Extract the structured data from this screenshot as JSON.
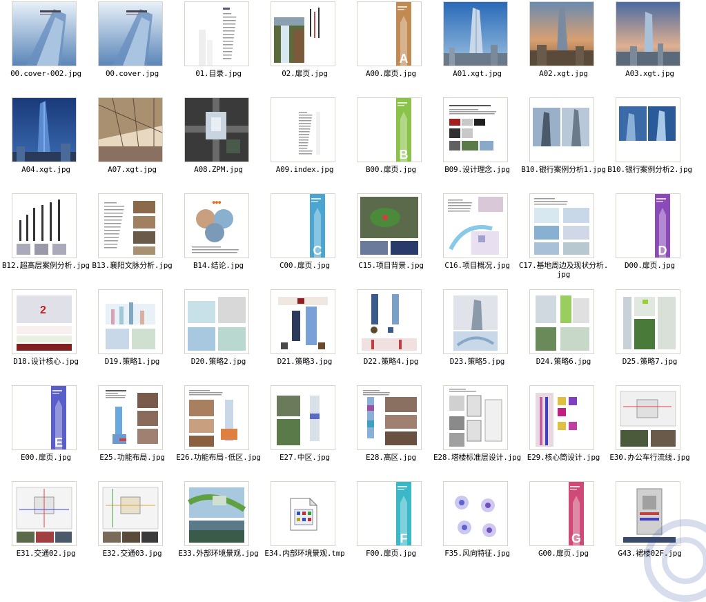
{
  "files": [
    {
      "name": "00.cover-002.jpg",
      "thumb": "cover"
    },
    {
      "name": "00.cover.jpg",
      "thumb": "cover"
    },
    {
      "name": "01.目录.jpg",
      "thumb": "toc"
    },
    {
      "name": "02.扉页.jpg",
      "thumb": "waterfall"
    },
    {
      "name": "A00.扉页.jpg",
      "thumb": "divider",
      "letter": "A",
      "color": "#c08a52"
    },
    {
      "name": "A01.xgt.jpg",
      "thumb": "tower_blue"
    },
    {
      "name": "A02.xgt.jpg",
      "thumb": "tower_sunset"
    },
    {
      "name": "A03.xgt.jpg",
      "thumb": "tower_city"
    },
    {
      "name": "A04.xgt.jpg",
      "thumb": "tower_night"
    },
    {
      "name": "A07.xgt.jpg",
      "thumb": "atrium"
    },
    {
      "name": "A08.ZPM.jpg",
      "thumb": "siteplan"
    },
    {
      "name": "A09.index.jpg",
      "thumb": "index"
    },
    {
      "name": "B00.扉页.jpg",
      "thumb": "divider",
      "letter": "B",
      "color": "#8ac24a"
    },
    {
      "name": "B09.设计理念.jpg",
      "thumb": "concept"
    },
    {
      "name": "B10.银行案例分析1.jpg",
      "thumb": "towers_pair"
    },
    {
      "name": "B10.银行案例分析2.jpg",
      "thumb": "towers_blue"
    },
    {
      "name": "B12.超高层案例分析.jpg",
      "thumb": "skyscraper_chart"
    },
    {
      "name": "B13.襄阳文脉分析.jpg",
      "thumb": "text_photos"
    },
    {
      "name": "B14.结论.jpg",
      "thumb": "circles"
    },
    {
      "name": "C00.扉页.jpg",
      "thumb": "divider",
      "letter": "C",
      "color": "#4aa6d0"
    },
    {
      "name": "C15.项目背景.jpg",
      "thumb": "map"
    },
    {
      "name": "C16.项目概况.jpg",
      "thumb": "site_diagram"
    },
    {
      "name": "C17.基地周边及现状分析.jpg",
      "thumb": "site_photos"
    },
    {
      "name": "D00.扉页.jpg",
      "thumb": "divider",
      "letter": "D",
      "color": "#8a4ab8"
    },
    {
      "name": "D18.设计核心.jpg",
      "thumb": "core"
    },
    {
      "name": "D19.策略1.jpg",
      "thumb": "strategy1"
    },
    {
      "name": "D20.策略2.jpg",
      "thumb": "strategy2"
    },
    {
      "name": "D21.策略3.jpg",
      "thumb": "strategy3"
    },
    {
      "name": "D22.策略4.jpg",
      "thumb": "strategy4"
    },
    {
      "name": "D23.策略5.jpg",
      "thumb": "strategy5"
    },
    {
      "name": "D24.策略6.jpg",
      "thumb": "strategy6"
    },
    {
      "name": "D25.策略7.jpg",
      "thumb": "strategy7"
    },
    {
      "name": "E00.扉页.jpg",
      "thumb": "divider",
      "letter": "E",
      "color": "#5a5ec8"
    },
    {
      "name": "E25.功能布局.jpg",
      "thumb": "function"
    },
    {
      "name": "E26.功能布局-低区.jpg",
      "thumb": "lowzone"
    },
    {
      "name": "E27.中区.jpg",
      "thumb": "midzone"
    },
    {
      "name": "E28.高区.jpg",
      "thumb": "highzone"
    },
    {
      "name": "E28.塔楼标准层设计.jpg",
      "thumb": "floorplan"
    },
    {
      "name": "E29.核心筒设计.jpg",
      "thumb": "corecolor"
    },
    {
      "name": "E30.办公车行流线.jpg",
      "thumb": "traffic"
    },
    {
      "name": "E31.交通02.jpg",
      "thumb": "traffic2"
    },
    {
      "name": "E32.交通03.jpg",
      "thumb": "traffic3"
    },
    {
      "name": "E33.外部环境景观.jpg",
      "thumb": "landscape"
    },
    {
      "name": "E34.内部环境景观.tmp",
      "thumb": "tmpfile"
    },
    {
      "name": "F00.扉页.jpg",
      "thumb": "divider",
      "letter": "F",
      "color": "#3ab8c8"
    },
    {
      "name": "F35.风向特征.jpg",
      "thumb": "wind"
    },
    {
      "name": "G00.扉页.jpg",
      "thumb": "divider",
      "letter": "G",
      "color": "#d04a78"
    },
    {
      "name": "G43.裙楼02F.jpg",
      "thumb": "podium"
    }
  ]
}
